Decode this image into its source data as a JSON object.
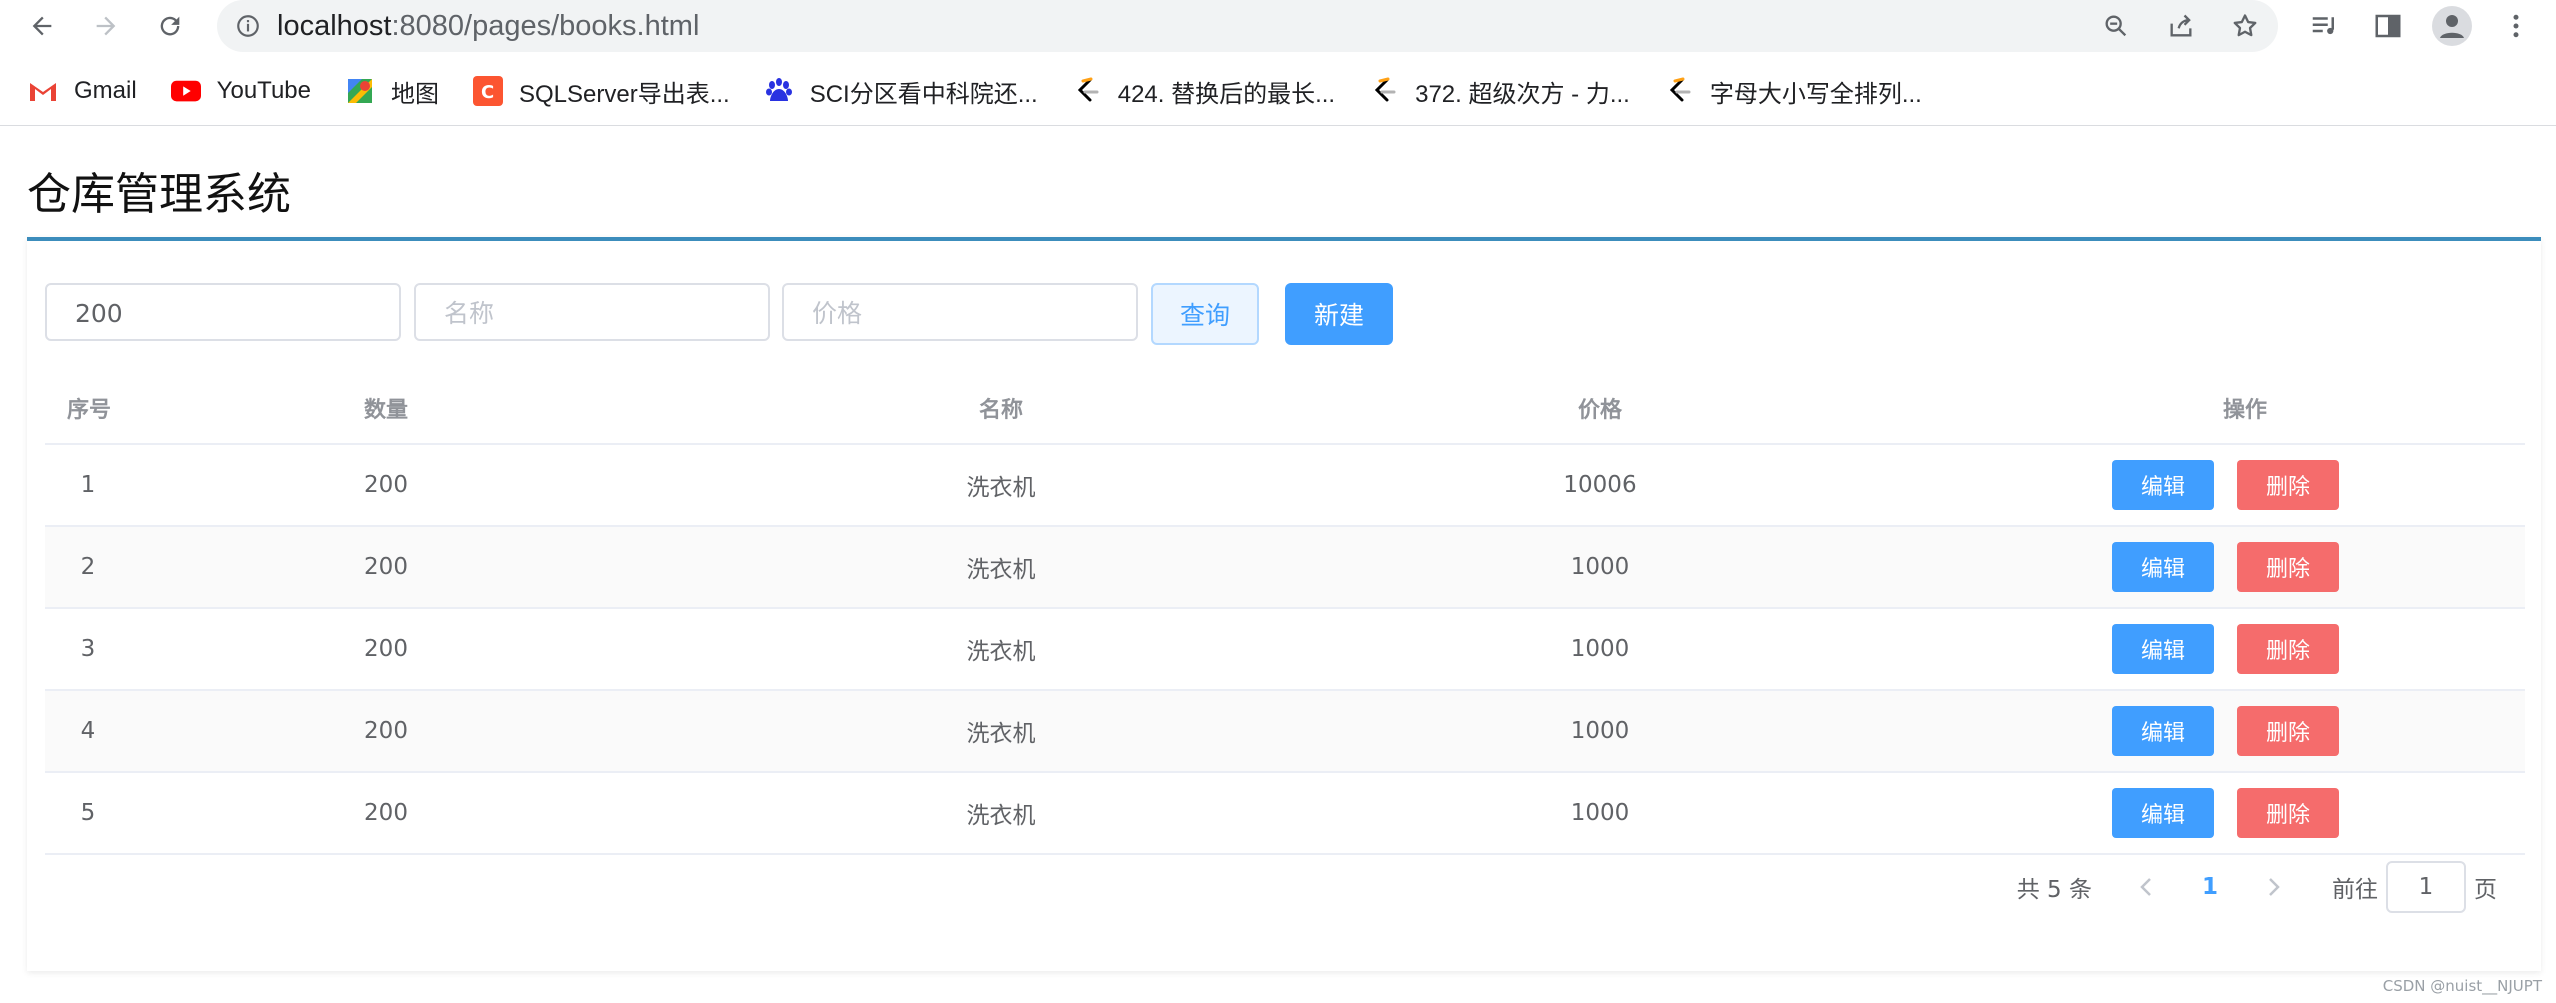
{
  "browser": {
    "url_host": "localhost",
    "url_rest": ":8080/pages/books.html",
    "bookmarks": [
      {
        "label": "Gmail",
        "icon": "gmail-icon"
      },
      {
        "label": "YouTube",
        "icon": "youtube-icon"
      },
      {
        "label": "地图",
        "icon": "maps-icon"
      },
      {
        "label": "SQLServer导出表...",
        "icon": "csdn-icon"
      },
      {
        "label": "SCI分区看中科院还...",
        "icon": "baidu-icon"
      },
      {
        "label": "424. 替换后的最长...",
        "icon": "leetcode-icon"
      },
      {
        "label": "372. 超级次方 - 力...",
        "icon": "leetcode-icon"
      },
      {
        "label": "字母大小写全排列...",
        "icon": "leetcode-icon"
      }
    ]
  },
  "page": {
    "title": "仓库管理系统"
  },
  "toolbar": {
    "quantity_value": "200",
    "name_placeholder": "名称",
    "price_placeholder": "价格",
    "query_label": "查询",
    "new_label": "新建"
  },
  "table": {
    "headers": {
      "index": "序号",
      "quantity": "数量",
      "name": "名称",
      "price": "价格",
      "ops": "操作"
    },
    "edit_label": "编辑",
    "delete_label": "删除",
    "rows": [
      {
        "index": "1",
        "quantity": "200",
        "name": "洗衣机",
        "price": "10006"
      },
      {
        "index": "2",
        "quantity": "200",
        "name": "洗衣机",
        "price": "1000"
      },
      {
        "index": "3",
        "quantity": "200",
        "name": "洗衣机",
        "price": "1000"
      },
      {
        "index": "4",
        "quantity": "200",
        "name": "洗衣机",
        "price": "1000"
      },
      {
        "index": "5",
        "quantity": "200",
        "name": "洗衣机",
        "price": "1000"
      }
    ]
  },
  "pagination": {
    "total_text": "共 5 条",
    "current_page": "1",
    "goto_label": "前往",
    "jump_value": "1",
    "page_unit": "页"
  },
  "watermark": "CSDN @nuist__NJUPT",
  "colors": {
    "primary": "#409eff",
    "danger": "#f56c6c",
    "header_border": "#3c8dbc"
  }
}
